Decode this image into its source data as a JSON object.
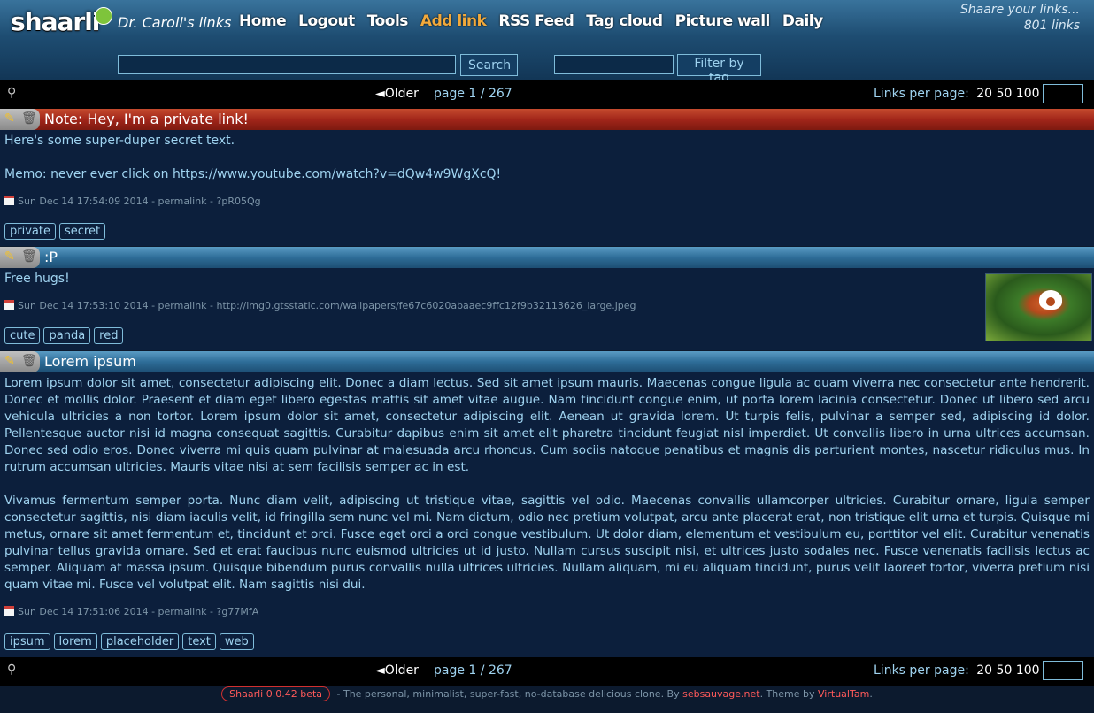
{
  "header": {
    "logo_text": "shaarli",
    "site_title": "Dr. Caroll's links",
    "nav": [
      {
        "label": "Home",
        "active": false
      },
      {
        "label": "Logout",
        "active": false
      },
      {
        "label": "Tools",
        "active": false
      },
      {
        "label": "Add link",
        "active": true
      },
      {
        "label": "RSS Feed",
        "active": false
      },
      {
        "label": "Tag cloud",
        "active": false
      },
      {
        "label": "Picture wall",
        "active": false
      },
      {
        "label": "Daily",
        "active": false
      }
    ],
    "tagline": "Shaare your links...",
    "link_count": "801 links",
    "search_value": "",
    "search_button": "Search",
    "tag_filter_value": "",
    "filter_button": "Filter by tag"
  },
  "paging": {
    "older": "◄Older",
    "page": "page 1 / 267",
    "links_per_page_label": "Links per page:",
    "links_per_page_options": "20 50 100",
    "custom_value": ""
  },
  "links": [
    {
      "title": "Note: Hey, I'm a private link!",
      "private": true,
      "description": [
        "Here's some super-duper secret text.",
        "Memo: never ever click on https://www.youtube.com/watch?v=dQw4w9WgXcQ!"
      ],
      "meta": "Sun Dec 14 17:54:09 2014 - permalink - ?pR05Qg",
      "tags": [
        "private",
        "secret"
      ]
    },
    {
      "title": ":P",
      "private": false,
      "description": [
        "Free hugs!"
      ],
      "meta": "Sun Dec 14 17:53:10 2014 - permalink - http://img0.gtsstatic.com/wallpapers/fe67c6020abaaec9ffc12f9b32113626_large.jpeg",
      "tags": [
        "cute",
        "panda",
        "red"
      ],
      "thumbnail": "red-panda-image"
    },
    {
      "title": "Lorem ipsum",
      "private": false,
      "description": [
        "Lorem ipsum dolor sit amet, consectetur adipiscing elit. Donec a diam lectus. Sed sit amet ipsum mauris. Maecenas congue ligula ac quam viverra nec consectetur ante hendrerit. Donec et mollis dolor. Praesent et diam eget libero egestas mattis sit amet vitae augue. Nam tincidunt congue enim, ut porta lorem lacinia consectetur. Donec ut libero sed arcu vehicula ultricies a non tortor. Lorem ipsum dolor sit amet, consectetur adipiscing elit. Aenean ut gravida lorem. Ut turpis felis, pulvinar a semper sed, adipiscing id dolor. Pellentesque auctor nisi id magna consequat sagittis. Curabitur dapibus enim sit amet elit pharetra tincidunt feugiat nisl imperdiet. Ut convallis libero in urna ultrices accumsan. Donec sed odio eros. Donec viverra mi quis quam pulvinar at malesuada arcu rhoncus. Cum sociis natoque penatibus et magnis dis parturient montes, nascetur ridiculus mus. In rutrum accumsan ultricies. Mauris vitae nisi at sem facilisis semper ac in est.",
        "Vivamus fermentum semper porta. Nunc diam velit, adipiscing ut tristique vitae, sagittis vel odio. Maecenas convallis ullamcorper ultricies. Curabitur ornare, ligula semper consectetur sagittis, nisi diam iaculis velit, id fringilla sem nunc vel mi. Nam dictum, odio nec pretium volutpat, arcu ante placerat erat, non tristique elit urna et turpis. Quisque mi metus, ornare sit amet fermentum et, tincidunt et orci. Fusce eget orci a orci congue vestibulum. Ut dolor diam, elementum et vestibulum eu, porttitor vel elit. Curabitur venenatis pulvinar tellus gravida ornare. Sed et erat faucibus nunc euismod ultricies ut id justo. Nullam cursus suscipit nisi, et ultrices justo sodales nec. Fusce venenatis facilisis lectus ac semper. Aliquam at massa ipsum. Quisque bibendum purus convallis nulla ultrices ultricies. Nullam aliquam, mi eu aliquam tincidunt, purus velit laoreet tortor, viverra pretium nisi quam vitae mi. Fusce vel volutpat elit. Nam sagittis nisi dui."
      ],
      "meta": "Sun Dec 14 17:51:06 2014 - permalink - ?g77MfA",
      "tags": [
        "ipsum",
        "lorem",
        "placeholder",
        "text",
        "web"
      ]
    }
  ],
  "footer": {
    "version": "Shaarli 0.0.42 beta",
    "text_1": " - The personal, minimalist, super-fast, no-database delicious clone. By ",
    "author": "sebsauvage.net",
    "text_2": ". Theme by ",
    "theme_author": "VirtualTam",
    "text_3": "."
  }
}
